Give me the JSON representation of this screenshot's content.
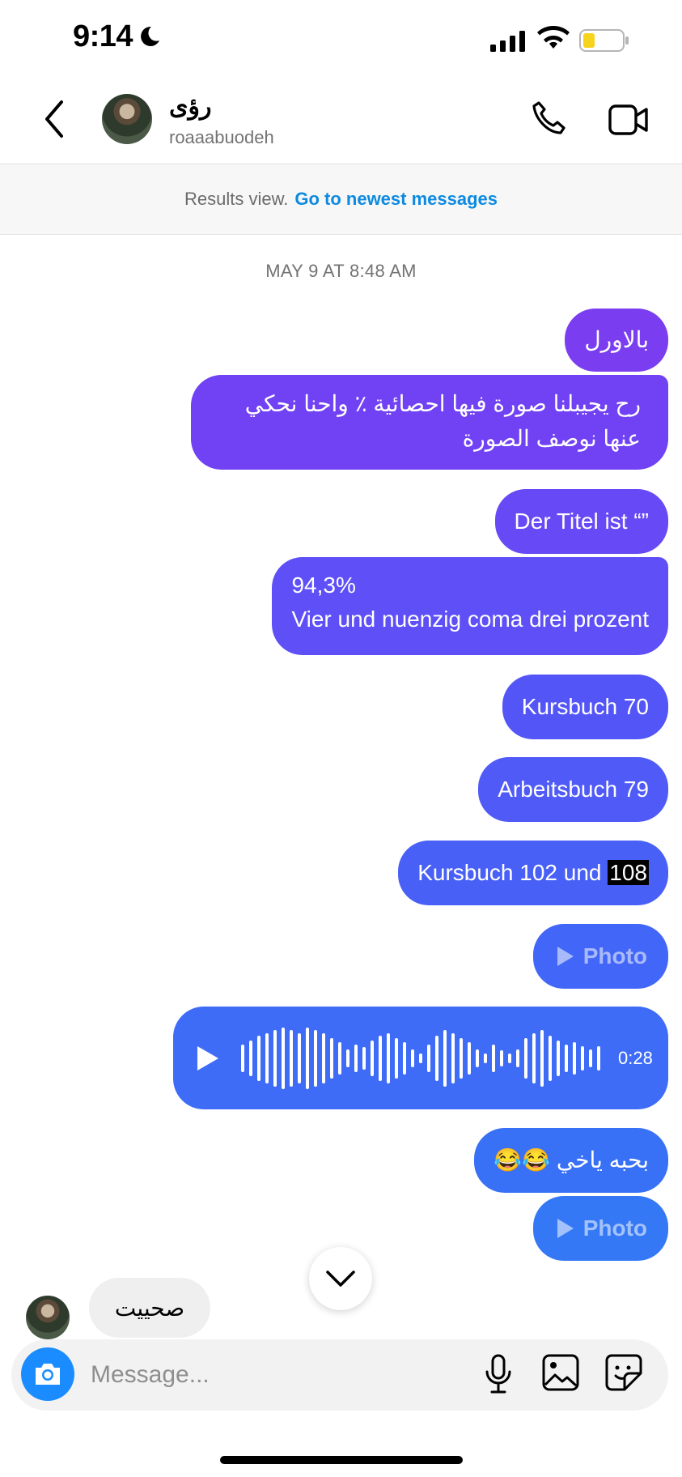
{
  "status_bar": {
    "time": "9:14"
  },
  "header": {
    "name": "رؤى",
    "username": "roaaabuodeh"
  },
  "banner": {
    "text": "Results view.",
    "link": "Go to newest messages"
  },
  "timestamp": "MAY 9 AT 8:48 AM",
  "messages": [
    {
      "text": "بالاورل"
    },
    {
      "line1": "رح يجيبلنا صورة فيها احصائية ٪ واحنا نحكي",
      "line2": "عنها نوصف الصورة"
    },
    {
      "text": "Der Titel ist “”"
    },
    {
      "line1": "94,3%",
      "line2": "Vier und nuenzig coma drei prozent"
    },
    {
      "text": "Kursbuch 70"
    },
    {
      "text": "Arbeitsbuch 79"
    },
    {
      "text": "Kursbuch 102 und ",
      "highlight": "108"
    },
    {
      "label": "Photo"
    },
    {
      "duration": "0:28"
    },
    {
      "text": "بحبه ياخي 😂😂"
    },
    {
      "label": "Photo"
    }
  ],
  "incoming": {
    "text": "صحييت"
  },
  "composer": {
    "placeholder": "Message..."
  },
  "colors": {
    "bubble_top": "#7a3df0",
    "bubble_bottom": "#3478f6",
    "accent": "#1a8cff",
    "link": "#0d8ae0"
  }
}
